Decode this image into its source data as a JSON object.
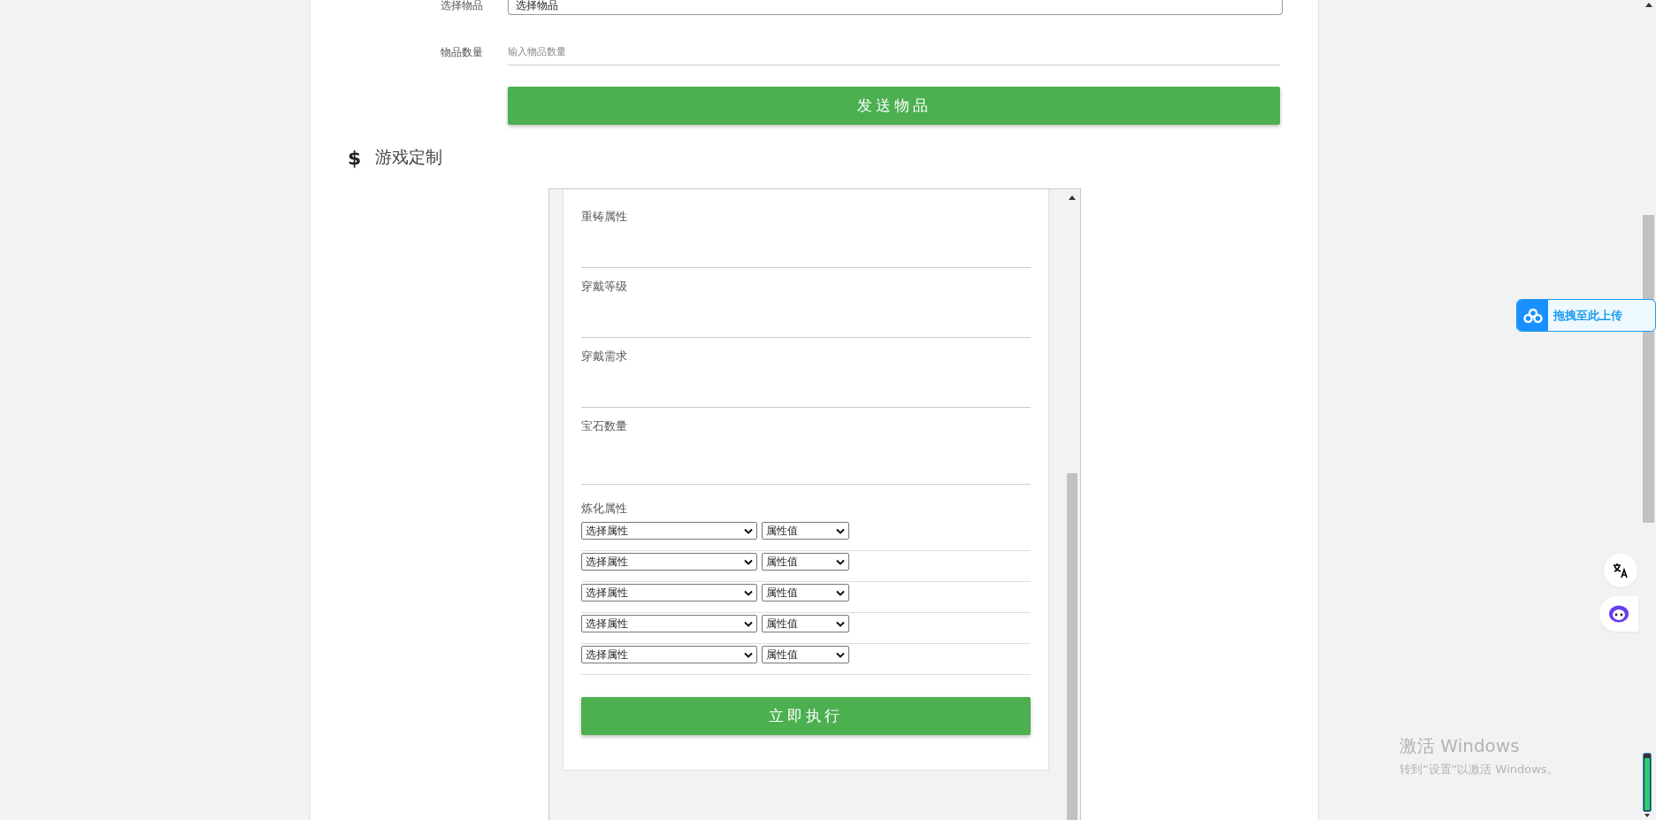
{
  "send_form": {
    "fields": [
      {
        "kind": "select",
        "label": "选择物品",
        "value": "选择物品"
      },
      {
        "kind": "input",
        "label": "物品数量",
        "placeholder": "输入物品数量"
      }
    ],
    "submit": "发送物品"
  },
  "section": {
    "symbol": "$",
    "title": "游戏定制"
  },
  "custom_panel": {
    "fields": [
      {
        "label": "重铸属性"
      },
      {
        "label": "穿戴等级"
      },
      {
        "label": "穿戴需求"
      },
      {
        "label": "宝石数量"
      }
    ],
    "smelting": {
      "label": "炼化属性",
      "rows": [
        {
          "attribute": "选择属性",
          "value": "属性值"
        },
        {
          "attribute": "选择属性",
          "value": "属性值"
        },
        {
          "attribute": "选择属性",
          "value": "属性值"
        },
        {
          "attribute": "选择属性",
          "value": "属性值"
        },
        {
          "attribute": "选择属性",
          "value": "属性值"
        }
      ]
    },
    "execute": "立即执行"
  },
  "upload_widget": {
    "label": "拖拽至此上传"
  },
  "activation": {
    "title": "激活 Windows",
    "hint": "转到“设置”以激活 Windows。"
  }
}
